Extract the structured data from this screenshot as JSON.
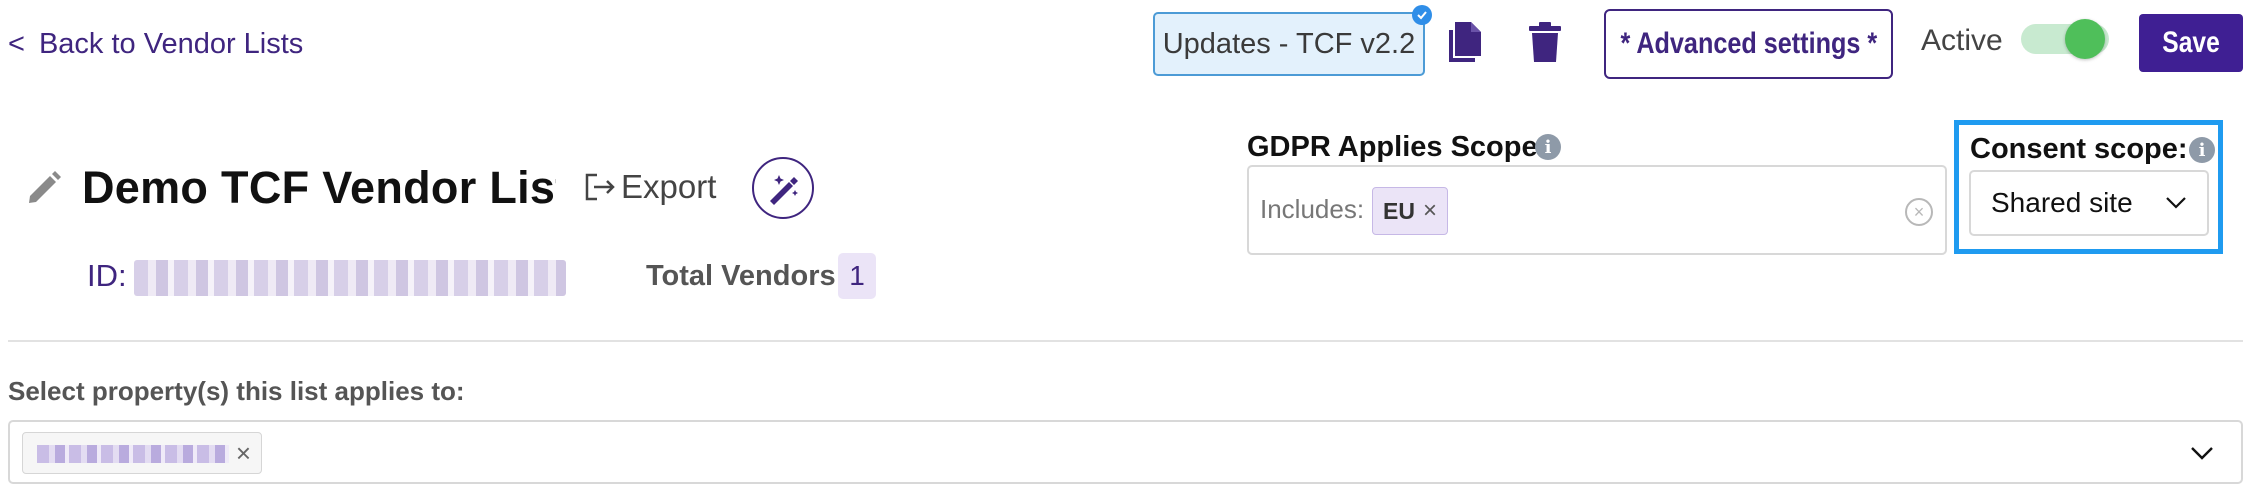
{
  "nav": {
    "back_chevron": "<",
    "back_label": "Back to Vendor Lists"
  },
  "toolbar": {
    "updates_label": "Updates - TCF v2.2",
    "advanced_label": "* Advanced settings *",
    "active_label": "Active",
    "active_on": true,
    "save_label": "Save",
    "copy_icon": "copy-icon",
    "delete_icon": "trash-icon"
  },
  "header": {
    "title": "Demo TCF Vendor List",
    "export_label": "Export",
    "id_label": "ID:",
    "total_vendors_label": "Total Vendors",
    "total_vendors_count": "1"
  },
  "gdpr": {
    "label": "GDPR Applies Scope:",
    "includes_label": "Includes:",
    "chips": [
      "EU"
    ]
  },
  "consent": {
    "label": "Consent scope:",
    "selected": "Shared site"
  },
  "properties": {
    "label": "Select property(s) this list applies to:"
  },
  "colors": {
    "brand": "#3f257f",
    "save_bg": "#3f1f93",
    "toggle_on": "#4fbf5a",
    "highlight": "#1f9bf0"
  }
}
